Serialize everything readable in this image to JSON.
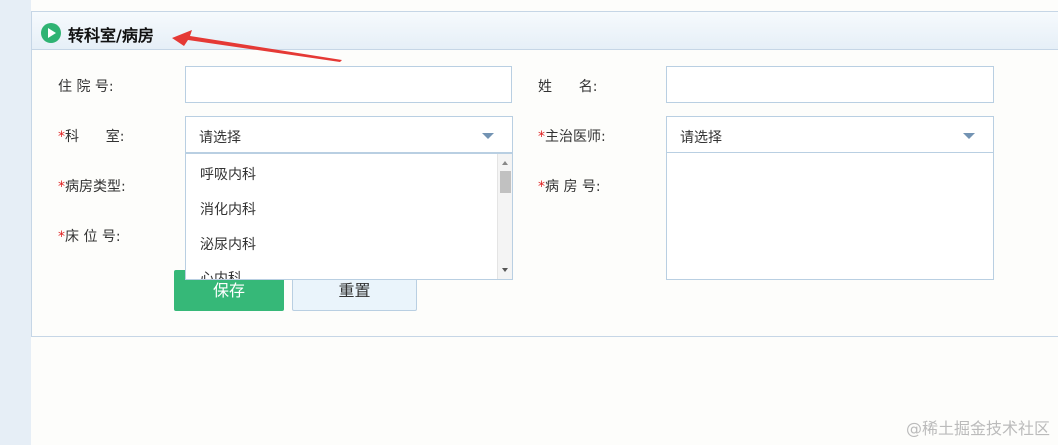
{
  "header": {
    "title": "转科室/病房"
  },
  "form": {
    "inpatient_no": {
      "label": "住 院 号:"
    },
    "name": {
      "label": "姓      名:"
    },
    "department": {
      "required": "*",
      "label": "科      室:",
      "value": "请选择"
    },
    "attending_doctor": {
      "required": "*",
      "label": "主治医师:",
      "value": "请选择"
    },
    "ward_type": {
      "required": "*",
      "label": "病房类型:"
    },
    "ward_no": {
      "required": "*",
      "label": "病 房 号:"
    },
    "bed_no": {
      "required": "*",
      "label": "床 位 号:"
    }
  },
  "department_dropdown": {
    "options": [
      "呼吸内科",
      "消化内科",
      "泌尿内科",
      "心内科"
    ]
  },
  "buttons": {
    "save": "保存",
    "reset": "重置"
  },
  "watermark": "@稀土掘金技术社区",
  "colors": {
    "accent": "#36b878",
    "border": "#b9cfe2",
    "required": "#e02020",
    "arrow": "#e53935"
  }
}
